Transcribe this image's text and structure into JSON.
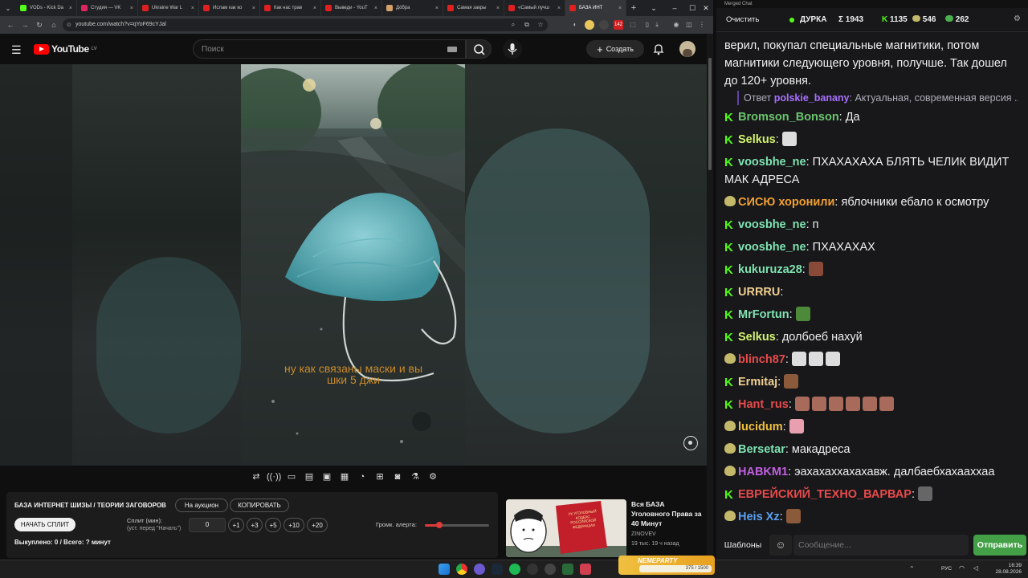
{
  "tabs": [
    {
      "label": "VODs - Kick Da",
      "color": "#53fc18",
      "active": false
    },
    {
      "label": "Студия — VK",
      "color": "#e0245e",
      "active": false
    },
    {
      "label": "Ukraine War L",
      "color": "#e02020",
      "active": false
    },
    {
      "label": "Ислам как ко",
      "color": "#e02020",
      "active": false
    },
    {
      "label": "Как нас трав",
      "color": "#e02020",
      "active": false
    },
    {
      "label": "Выведи - YouT",
      "color": "#e02020",
      "active": false
    },
    {
      "label": "Дöбра",
      "color": "#d6a06a",
      "active": false
    },
    {
      "label": "Самая закры",
      "color": "#e02020",
      "active": false
    },
    {
      "label": "«Самый лучш",
      "color": "#e02020",
      "active": false
    },
    {
      "label": "БАЗА ИНТ",
      "color": "#e02020",
      "active": true
    }
  ],
  "address": {
    "url": "youtube.com/watch?v=qYoF69cYJal"
  },
  "youtube": {
    "logo": "YouTube",
    "region": "LV",
    "search_placeholder": "Поиск",
    "create_label": "Создать"
  },
  "video": {
    "subtitle_line1": "ну как связаны маски и вы",
    "subtitle_line2": "шки 5 джи"
  },
  "extension": {
    "title": "БАЗА ИНТЕРНЕТ ШИЗЫ / ТЕОРИИ ЗАГОВОРОВ",
    "auction_label": "На аукцион",
    "copy_label": "КОПИРОВАТЬ",
    "start_split_label": "НАЧАТЬ СПЛИТ",
    "split_label": "Сплит (мин):",
    "split_hint": "(уст. перед \"Начать\")",
    "split_value": "0",
    "increments": [
      "+1",
      "+3",
      "+5",
      "+10",
      "+20"
    ],
    "volume_label": "Громк. алерта:",
    "volume_level": 0.23,
    "status": "Выкуплено: 0 / Всего: ? минут"
  },
  "recommendation": {
    "title": "Вся БАЗА Уголовного Права за 40 Минут",
    "channel": "ZINOVEV",
    "meta": "19 тыс.  19 ч назад",
    "thumb_text": "УК УГОЛОВНЫЙ КОДЕКС РОССИЙСКОЙ ФЕДЕРАЦИИ"
  },
  "taskbar": {
    "lang": "РУС",
    "time": "16:39",
    "date": "28.08.2026",
    "overlay_text": "NEMEPARTY",
    "overlay_count": "375 / 1500"
  },
  "chat": {
    "window_title": "Merged Chat",
    "clear_label": "Очистить",
    "channel": "ДУРКА",
    "total_label": "Σ 1943",
    "kick_count": "1135",
    "yt_count": "546",
    "other_count": "262",
    "top_text": "верил, покупал специальные магнитики, потом магнитики следующего уровня, получше. Так дошел до 120+ уровня.",
    "reply_prefix": "Ответ",
    "reply_user": "polskie_banany",
    "reply_text": "Актуальная, современная версия ...",
    "messages": [
      {
        "platform": "kick",
        "user": "Bromson_Bonson",
        "color": "#6bc46d",
        "text": "Да",
        "emotes": []
      },
      {
        "platform": "kick",
        "user": "Selkus",
        "color": "#d3f36b",
        "text": "",
        "emotes": [
          "#ddd"
        ]
      },
      {
        "platform": "kick",
        "user": "voosbhe_ne",
        "color": "#7fe3b2",
        "text": "ПХАХАХАХА БЛЯТЬ ЧЕЛИК ВИДИТ МАК АДРЕСА",
        "emotes": []
      },
      {
        "platform": "yt",
        "user": "СИСЮ хоронили",
        "color": "#f0a030",
        "text": "яблочники ебало к осмотру",
        "emotes": []
      },
      {
        "platform": "kick",
        "user": "voosbhe_ne",
        "color": "#7fe3b2",
        "text": "п",
        "emotes": []
      },
      {
        "platform": "kick",
        "user": "voosbhe_ne",
        "color": "#7fe3b2",
        "text": "ПХАХАХАХ",
        "emotes": []
      },
      {
        "platform": "kick",
        "user": "kukuruza28",
        "color": "#7fe3b2",
        "text": "",
        "emotes": [
          "#8a4a3a"
        ]
      },
      {
        "platform": "kick",
        "user": "URRRU",
        "color": "#f0d090",
        "text": "",
        "emotes": []
      },
      {
        "platform": "kick",
        "user": "MrFortun",
        "color": "#7fe3b2",
        "text": "",
        "emotes": [
          "#4c8a3a"
        ]
      },
      {
        "platform": "kick",
        "user": "Selkus",
        "color": "#d3f36b",
        "text": "долбоеб нахуй",
        "emotes": []
      },
      {
        "platform": "yt",
        "user": "blinch87",
        "color": "#e84a4a",
        "text": "",
        "emotes": [
          "#ddd",
          "#ddd",
          "#ddd"
        ]
      },
      {
        "platform": "kick",
        "user": "Ermitaj",
        "color": "#f0d090",
        "text": "",
        "emotes": [
          "#8a5a3a"
        ]
      },
      {
        "platform": "kick",
        "user": "Hant_rus",
        "color": "#e84a4a",
        "text": "",
        "emotes": [
          "#a86a5a",
          "#a86a5a",
          "#a86a5a",
          "#a86a5a",
          "#a86a5a",
          "#a86a5a"
        ]
      },
      {
        "platform": "yt",
        "user": "lucidum",
        "color": "#f0c040",
        "text": "",
        "emotes": [
          "#e8a0b0"
        ]
      },
      {
        "platform": "yt",
        "user": "Bersetar",
        "color": "#7fe3b2",
        "text": "макадреса",
        "emotes": []
      },
      {
        "platform": "yt",
        "user": "HABKM1",
        "color": "#c060e0",
        "text": "эахахаххахахавж. далбаебхахааххаа",
        "emotes": []
      },
      {
        "platform": "kick",
        "user": "ЕВРЕЙСКИЙ_ТЕХНО_ВАРВАР",
        "color": "#e84a4a",
        "text": "",
        "emotes": [
          "#666"
        ]
      },
      {
        "platform": "yt",
        "user": "Heis Xz",
        "color": "#5aa0f0",
        "text": "",
        "emotes": [
          "#8a5a3a"
        ]
      }
    ],
    "templates_label": "Шаблоны",
    "input_placeholder": "Сообщение...",
    "send_label": "Отправить"
  }
}
